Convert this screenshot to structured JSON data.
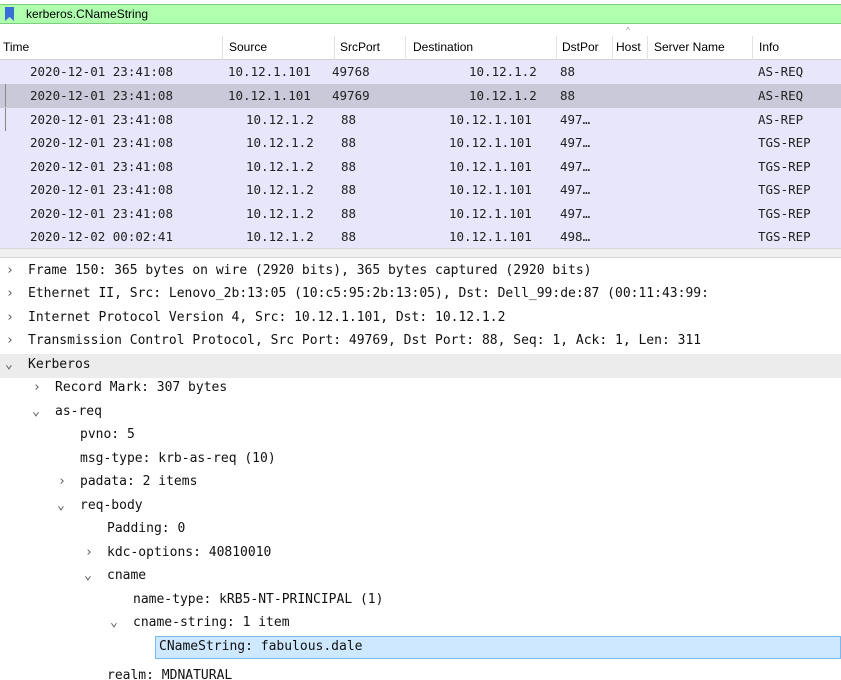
{
  "filter": {
    "text": "kerberos.CNameString",
    "icon": "bookmark-icon"
  },
  "columns": [
    "Time",
    "Source",
    "SrcPort",
    "Destination",
    "DstPor",
    "Host",
    "Server Name",
    "Info"
  ],
  "packets": [
    {
      "time": "2020-12-01 23:41:08",
      "source": "10.12.1.101",
      "srcport": "49768",
      "destination": "10.12.1.2",
      "dstport": "88",
      "info": "AS-REQ"
    },
    {
      "time": "2020-12-01 23:41:08",
      "source": "10.12.1.101",
      "srcport": "49769",
      "destination": "10.12.1.2",
      "dstport": "88",
      "info": "AS-REQ"
    },
    {
      "time": "2020-12-01 23:41:08",
      "source": "10.12.1.2",
      "srcport": "88",
      "destination": "10.12.1.101",
      "dstport": "497…",
      "info": "AS-REP"
    },
    {
      "time": "2020-12-01 23:41:08",
      "source": "10.12.1.2",
      "srcport": "88",
      "destination": "10.12.1.101",
      "dstport": "497…",
      "info": "TGS-REP"
    },
    {
      "time": "2020-12-01 23:41:08",
      "source": "10.12.1.2",
      "srcport": "88",
      "destination": "10.12.1.101",
      "dstport": "497…",
      "info": "TGS-REP"
    },
    {
      "time": "2020-12-01 23:41:08",
      "source": "10.12.1.2",
      "srcport": "88",
      "destination": "10.12.1.101",
      "dstport": "497…",
      "info": "TGS-REP"
    },
    {
      "time": "2020-12-01 23:41:08",
      "source": "10.12.1.2",
      "srcport": "88",
      "destination": "10.12.1.101",
      "dstport": "497…",
      "info": "TGS-REP"
    },
    {
      "time": "2020-12-02 00:02:41",
      "source": "10.12.1.2",
      "srcport": "88",
      "destination": "10.12.1.101",
      "dstport": "498…",
      "info": "TGS-REP"
    }
  ],
  "tree": [
    {
      "text": "Frame 150: 365 bytes on wire (2920 bits), 365 bytes captured (2920 bits)",
      "arrow": "›"
    },
    {
      "text": "Ethernet II, Src: Lenovo_2b:13:05 (10:c5:95:2b:13:05), Dst: Dell_99:de:87 (00:11:43:99:",
      "arrow": "›"
    },
    {
      "text": "Internet Protocol Version 4, Src: 10.12.1.101, Dst: 10.12.1.2",
      "arrow": "›"
    },
    {
      "text": "Transmission Control Protocol, Src Port: 49769, Dst Port: 88, Seq: 1, Ack: 1, Len: 311",
      "arrow": "›"
    },
    {
      "text": "Kerberos",
      "arrow": "⌄"
    },
    {
      "text": "Record Mark: 307 bytes",
      "arrow": "›"
    },
    {
      "text": "as-req",
      "arrow": "⌄"
    },
    {
      "text": "pvno: 5",
      "arrow": ""
    },
    {
      "text": "msg-type: krb-as-req (10)",
      "arrow": ""
    },
    {
      "text": "padata: 2 items",
      "arrow": "›"
    },
    {
      "text": "req-body",
      "arrow": "⌄"
    },
    {
      "text": "Padding: 0",
      "arrow": ""
    },
    {
      "text": "kdc-options: 40810010",
      "arrow": "›"
    },
    {
      "text": "cname",
      "arrow": "⌄"
    },
    {
      "text": "name-type: kRB5-NT-PRINCIPAL (1)",
      "arrow": ""
    },
    {
      "text": "cname-string: 1 item",
      "arrow": "⌄"
    },
    {
      "text": "CNameString: fabulous.dale",
      "arrow": ""
    },
    {
      "text": "realm: MDNATURAL",
      "arrow": ""
    }
  ]
}
